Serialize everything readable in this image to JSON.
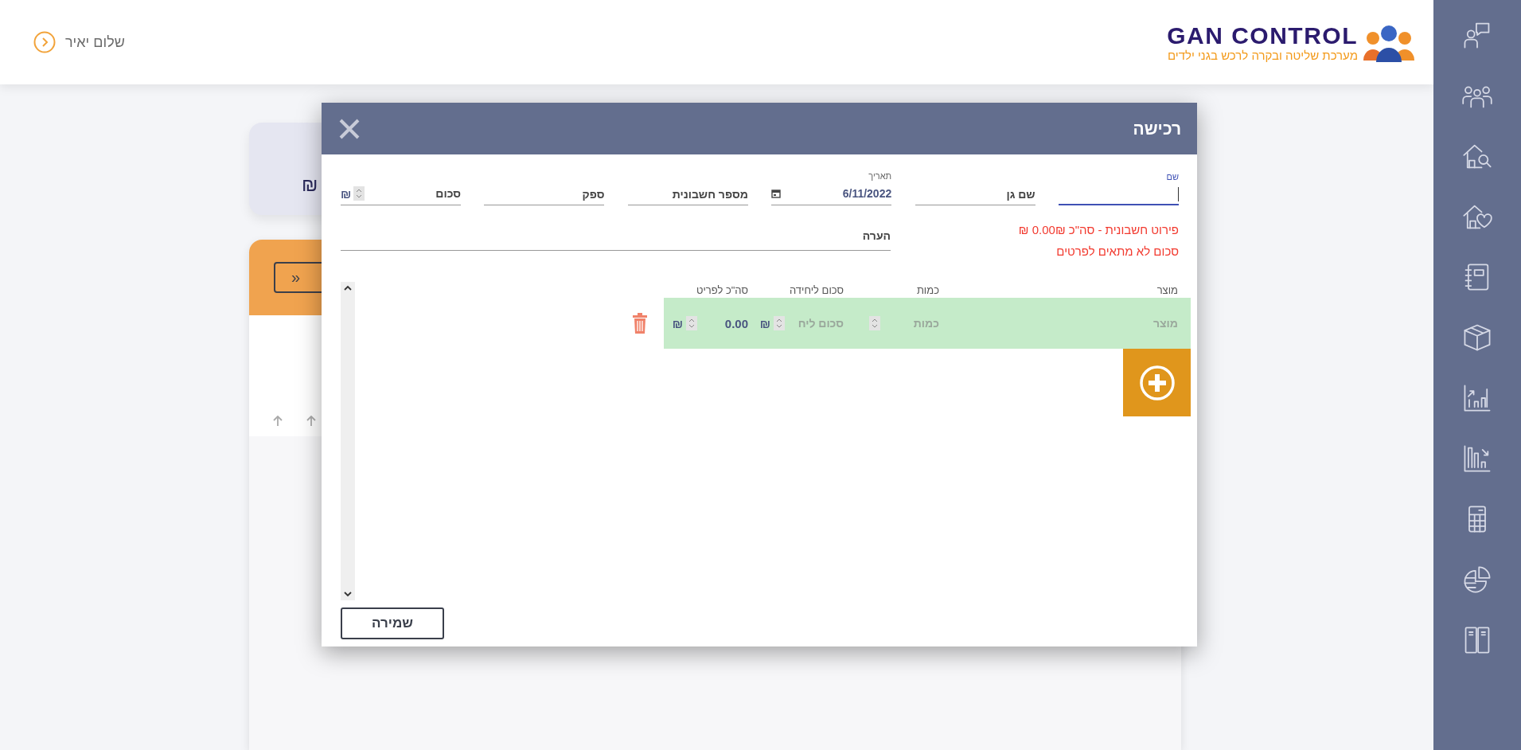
{
  "header": {
    "greeting": "שלום יאיר",
    "logo": {
      "title": "GAN CONTROL",
      "subtitle": "מערכת שליטה ובקרה לרכש בגני ילדים"
    }
  },
  "background": {
    "summary_card": {
      "amount": "₪"
    },
    "orange_card": {
      "button": "»"
    }
  },
  "modal": {
    "title": "רכישה",
    "fields": [
      {
        "kind": "text",
        "label": "שם",
        "focused": true
      },
      {
        "kind": "text",
        "placeholder": "שם גן",
        "focused": false
      },
      {
        "kind": "date",
        "label": "תאריך",
        "value": "6/11/2022",
        "focused": false
      },
      {
        "kind": "text",
        "placeholder": "מספר חשבונית",
        "focused": false
      },
      {
        "kind": "text",
        "placeholder": "ספק",
        "focused": false
      },
      {
        "kind": "money",
        "placeholder": "סכום",
        "currency": "₪",
        "focused": false
      }
    ],
    "note": {
      "placeholder": "הערה"
    },
    "errors": [
      "פירוט חשבונית - סה\"כ 0.00₪ ₪",
      "סכום לא מתאים לפרטים"
    ],
    "items": {
      "columns": [
        "מוצר",
        "כמות",
        "סכום ליחידה",
        "סה\"כ לפריט"
      ],
      "rows": [
        {
          "product_placeholder": "מוצר",
          "quantity_placeholder": "כמות",
          "unit_price_placeholder": "סכום ליח",
          "unit_currency": "₪",
          "total": "0.00",
          "total_currency": "₪"
        }
      ]
    },
    "save_button": "שמירה"
  }
}
